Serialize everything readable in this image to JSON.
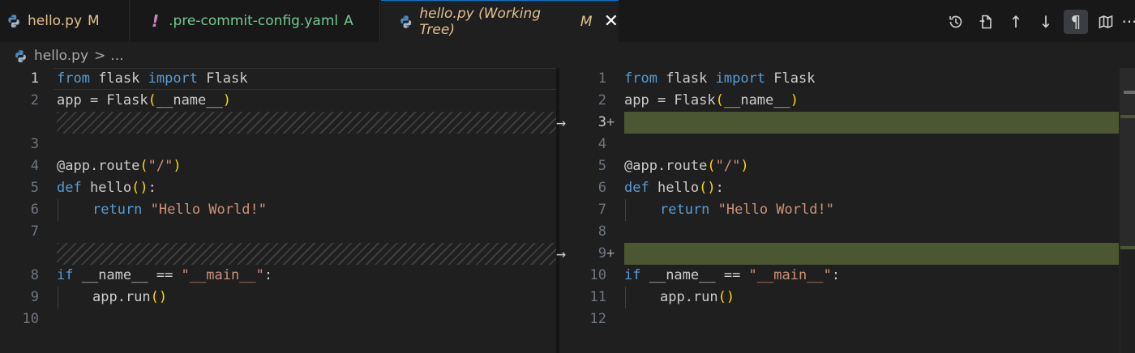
{
  "tabs": [
    {
      "title": "hello.py",
      "status": "M"
    },
    {
      "icon": "!",
      "title": ".pre-commit-config.yaml",
      "status": "A"
    },
    {
      "title": "hello.py (Working Tree)",
      "status": "M",
      "close": "✕"
    }
  ],
  "toolbar": {
    "more": "···",
    "pilcrow": "¶",
    "up": "↑",
    "down": "↓"
  },
  "breadcrumb": {
    "file": "hello.py",
    "sep": ">",
    "rest": "..."
  },
  "diff": {
    "arrow": "→",
    "plus": "+",
    "left_numbers": [
      "1",
      "2",
      "3",
      "4",
      "5",
      "6",
      "7",
      "8",
      "9",
      "10"
    ],
    "right_numbers": [
      "1",
      "2",
      "3",
      "4",
      "5",
      "6",
      "7",
      "8",
      "9",
      "10",
      "11",
      "12"
    ]
  },
  "code": {
    "from": "from",
    "flask": " flask ",
    "import": "import",
    "Flask": " Flask",
    "app_eq": "app = ",
    "Flask2": "Flask",
    "name_arg": "__name__",
    "decorator": "@app.route",
    "route_str": "\"/\"",
    "def": "def",
    "hello": " hello",
    "return": "return",
    "hello_str": " \"Hello World!\"",
    "if": "if",
    "if_rest": " __name__ == ",
    "main_str": "\"__main__\"",
    "colon": ":",
    "apprun": "app.run",
    "lparen": "(",
    "rparen": ")",
    "parens": "()"
  },
  "colors": {
    "inserted": "#4b5632",
    "keyword": "#569cd6",
    "string": "#ce9178",
    "bracket": "#ffd700",
    "modified": "#e2c08d",
    "added": "#73c991"
  }
}
